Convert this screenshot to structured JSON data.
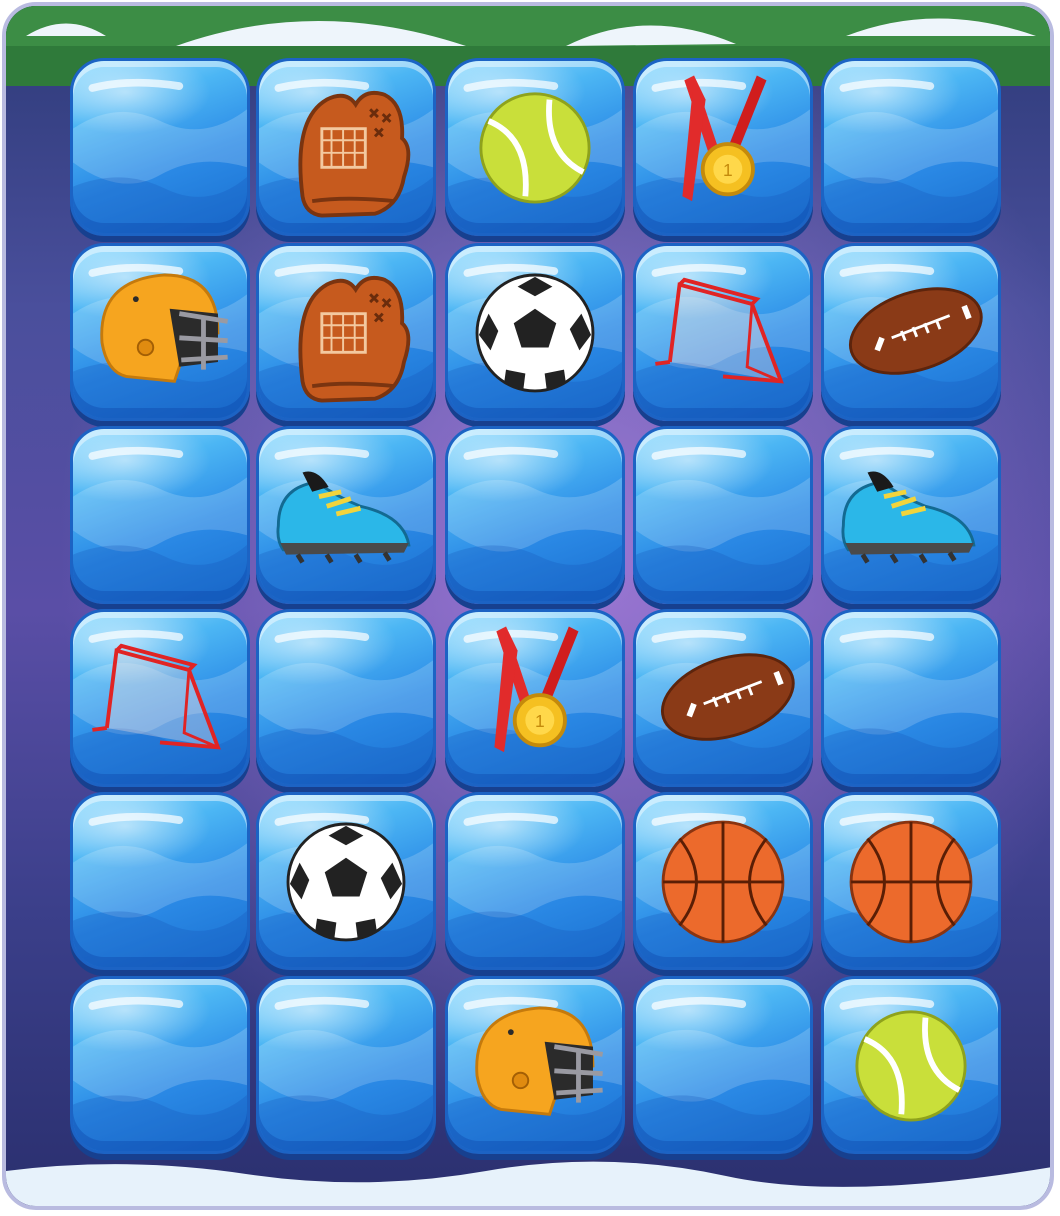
{
  "game": {
    "type": "memory-match",
    "rows": 6,
    "cols": 5
  },
  "colors": {
    "tile": "#2b8ae6",
    "tile_border": "#1c63c4",
    "frame": "#b9bbe0",
    "background": "#3b3b8a"
  },
  "tiles": [
    {
      "state": "hidden"
    },
    {
      "state": "revealed",
      "item": "baseball-glove"
    },
    {
      "state": "revealed",
      "item": "tennis-ball"
    },
    {
      "state": "revealed",
      "item": "medal"
    },
    {
      "state": "hidden"
    },
    {
      "state": "revealed",
      "item": "football-helmet"
    },
    {
      "state": "revealed",
      "item": "baseball-glove"
    },
    {
      "state": "revealed",
      "item": "soccer-ball"
    },
    {
      "state": "revealed",
      "item": "hockey-goal"
    },
    {
      "state": "revealed",
      "item": "american-football"
    },
    {
      "state": "hidden"
    },
    {
      "state": "revealed",
      "item": "cleat-shoe"
    },
    {
      "state": "hidden"
    },
    {
      "state": "hidden"
    },
    {
      "state": "revealed",
      "item": "cleat-shoe"
    },
    {
      "state": "revealed",
      "item": "hockey-goal"
    },
    {
      "state": "hidden"
    },
    {
      "state": "revealed",
      "item": "medal"
    },
    {
      "state": "revealed",
      "item": "american-football"
    },
    {
      "state": "hidden"
    },
    {
      "state": "hidden"
    },
    {
      "state": "revealed",
      "item": "soccer-ball"
    },
    {
      "state": "hidden"
    },
    {
      "state": "revealed",
      "item": "basketball"
    },
    {
      "state": "revealed",
      "item": "basketball"
    },
    {
      "state": "hidden"
    },
    {
      "state": "hidden"
    },
    {
      "state": "revealed",
      "item": "football-helmet"
    },
    {
      "state": "hidden"
    },
    {
      "state": "revealed",
      "item": "tennis-ball"
    }
  ]
}
